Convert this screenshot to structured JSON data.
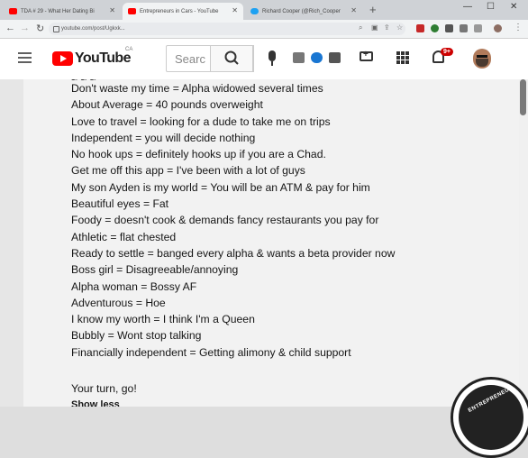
{
  "browser": {
    "tabs": [
      {
        "title": "TDA # 29 - What Her Dating Bi",
        "favicon_color": "#ff0000",
        "active": false
      },
      {
        "title": "Entrepreneurs in Cars - YouTube",
        "favicon_color": "#ff0000",
        "active": true
      },
      {
        "title": "Richard Cooper (@Rich_Cooper",
        "favicon_color": "#1da1f2",
        "active": false
      }
    ],
    "url": "youtube.com/post/Ugkxk...",
    "window_controls": {
      "minimize": "—",
      "maximize": "☐",
      "close": "✕"
    }
  },
  "youtube": {
    "logo_text": "YouTube",
    "country_code": "CA",
    "search_placeholder": "Searc",
    "notification_count": "9+"
  },
  "post": {
    "lines": [
      "Don't waste my time = Alpha widowed several times",
      "About Average = 40 pounds overweight",
      "Love to travel = looking for a dude to take me on trips",
      "Independent = you will decide nothing",
      "No hook ups = definitely hooks up if you are a Chad.",
      "Get me off this app = I've been with a lot of guys",
      "My son Ayden is my world = You will be an ATM & pay for him",
      "Beautiful eyes = Fat",
      "Foody = doesn't cook & demands fancy restaurants you pay for",
      "Athletic = flat chested",
      "Ready to settle = banged every alpha & wants a beta provider now",
      "Boss girl = Disagreeable/annoying",
      "Alpha woman = Bossy AF",
      "Adventurous = Hoe",
      "I know my worth = I think I'm a Queen",
      "Bubbly = Wont stop talking",
      "Financially independent = Getting alimony & child support"
    ],
    "closing": "Your turn, go!",
    "show_less": "Show less"
  },
  "watermark": {
    "text": "ENTREPRENEURS IN CARS"
  },
  "colors": {
    "youtube_red": "#ff0000",
    "badge_red": "#cc0000",
    "twitter_blue": "#1da1f2"
  }
}
